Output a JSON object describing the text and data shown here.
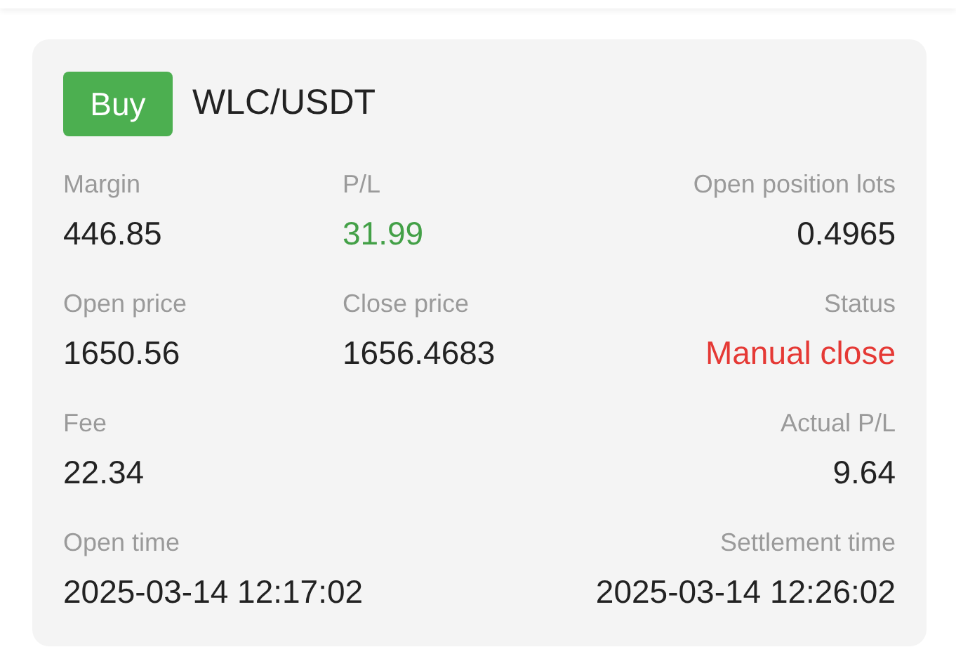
{
  "order": {
    "side": "Buy",
    "pair": "WLC/USDT"
  },
  "rows": [
    {
      "fields": [
        {
          "kind": "start",
          "label": "Margin",
          "value": "446.85",
          "color": "#222222"
        },
        {
          "kind": "middle",
          "label": "P/L",
          "value": "31.99",
          "color": "#43a047"
        },
        {
          "kind": "end",
          "label": "Open position lots",
          "value": "0.4965",
          "color": "#222222"
        }
      ]
    },
    {
      "fields": [
        {
          "kind": "start",
          "label": "Open price",
          "value": "1650.56",
          "color": "#222222"
        },
        {
          "kind": "middle",
          "label": "Close price",
          "value": "1656.4683",
          "color": "#222222"
        },
        {
          "kind": "end",
          "label": "Status",
          "value": "Manual close",
          "color": "#e53935"
        }
      ]
    },
    {
      "fields": [
        {
          "kind": "start",
          "label": "Fee",
          "value": "22.34",
          "color": "#222222"
        },
        {
          "kind": "end",
          "label": "Actual P/L",
          "value": "9.64",
          "color": "#222222"
        }
      ]
    },
    {
      "fields": [
        {
          "kind": "start",
          "label": "Open time",
          "value": "2025-03-14 12:17:02",
          "color": "#222222"
        },
        {
          "kind": "end",
          "label": "Settlement time",
          "value": "2025-03-14 12:26:02",
          "color": "#222222"
        }
      ]
    }
  ]
}
